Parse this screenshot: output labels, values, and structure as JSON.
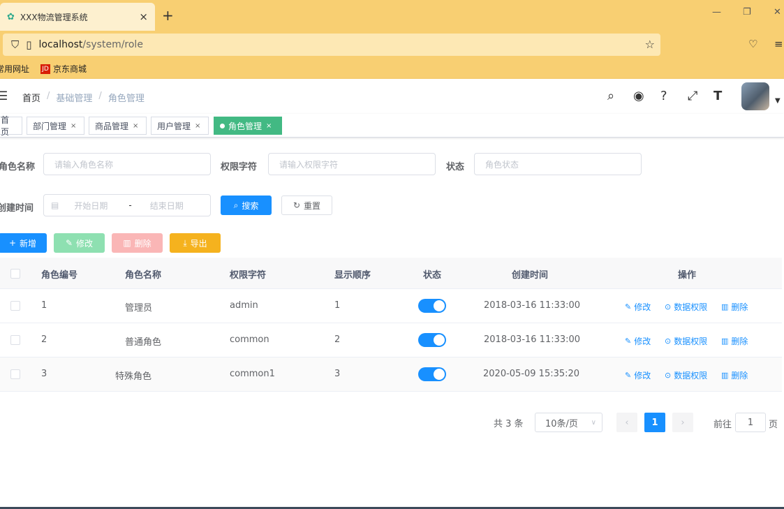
{
  "browser": {
    "tab_title": "XXX物流管理系统",
    "url_host": "localhost",
    "url_path": "/system/role",
    "bookmarks": [
      "常用网址",
      "京东商城"
    ],
    "jd_logo": "JD"
  },
  "navbar": {
    "breadcrumb": [
      "首页",
      "基础管理",
      "角色管理"
    ]
  },
  "tags": [
    {
      "label": "首页"
    },
    {
      "label": "部门管理"
    },
    {
      "label": "商品管理"
    },
    {
      "label": "用户管理"
    },
    {
      "label": "角色管理"
    }
  ],
  "search": {
    "role_name_label": "角色名称",
    "role_name_placeholder": "请输入角色名称",
    "perm_label": "权限字符",
    "perm_placeholder": "请输入权限字符",
    "status_label": "状态",
    "status_placeholder": "角色状态",
    "created_label": "创建时间",
    "start_placeholder": "开始日期",
    "range_sep": "-",
    "end_placeholder": "结束日期",
    "search_btn": "搜索",
    "reset_btn": "重置"
  },
  "toolbar": {
    "add": "新增",
    "edit": "修改",
    "delete": "删除",
    "export": "导出"
  },
  "table": {
    "headers": [
      "角色编号",
      "角色名称",
      "权限字符",
      "显示顺序",
      "状态",
      "创建时间",
      "操作"
    ],
    "rows": [
      {
        "id": "1",
        "name": "管理员",
        "key": "admin",
        "order": "1",
        "enabled": true,
        "created": "2018-03-16 11:33:00"
      },
      {
        "id": "2",
        "name": "普通角色",
        "key": "common",
        "order": "2",
        "enabled": true,
        "created": "2018-03-16 11:33:00"
      },
      {
        "id": "3",
        "name": "特殊角色",
        "key": "common1",
        "order": "3",
        "enabled": true,
        "created": "2020-05-09 15:35:20"
      }
    ],
    "ops": {
      "edit": "修改",
      "data_scope": "数据权限",
      "delete": "删除"
    }
  },
  "pagination": {
    "total": "共 3 条",
    "page_size": "10条/页",
    "current": "1",
    "goto_prefix": "前往",
    "goto_value": "1",
    "goto_suffix": "页"
  },
  "colors": {
    "primary": "#1890ff",
    "success": "#42b983",
    "warning": "#f5b21e",
    "danger": "#fab6b6",
    "chrome": "#f8cf72"
  }
}
